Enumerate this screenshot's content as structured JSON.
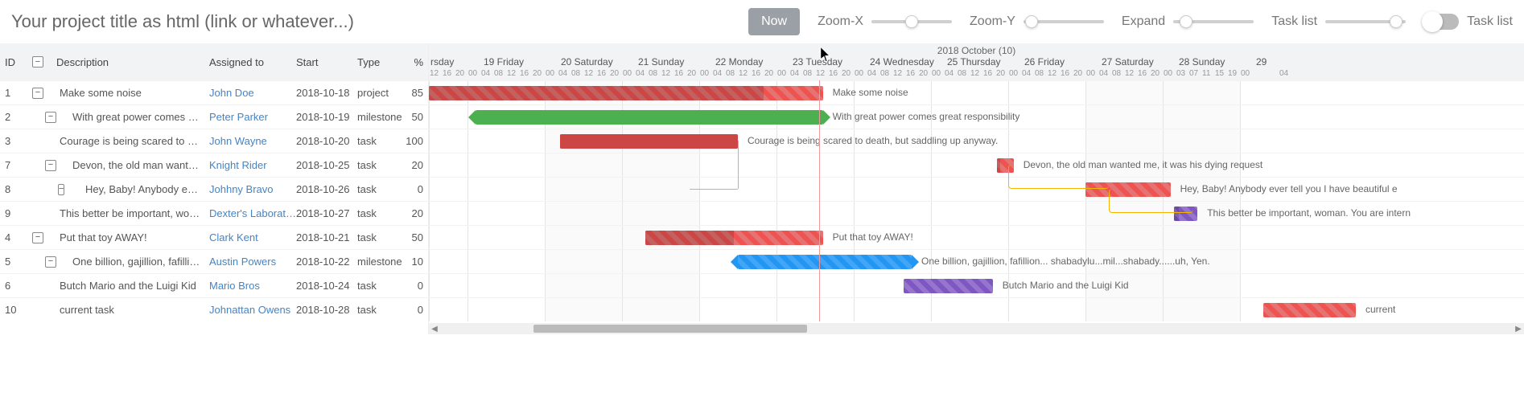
{
  "header": {
    "title": "Your project title as html (link or whatever...)",
    "now_button": "Now",
    "zoom_x": "Zoom-X",
    "zoom_y": "Zoom-Y",
    "expand": "Expand",
    "task_list": "Task list",
    "task_list_switch": "Task list"
  },
  "calendar": {
    "month_label": "2018 October (10)",
    "visible_start_label": "rsday",
    "days": [
      {
        "label": "rsday",
        "dow": 4,
        "weekend": false
      },
      {
        "label": "19 Friday",
        "dow": 5,
        "weekend": false
      },
      {
        "label": "20 Saturday",
        "dow": 6,
        "weekend": true
      },
      {
        "label": "21 Sunday",
        "dow": 0,
        "weekend": true
      },
      {
        "label": "22 Monday",
        "dow": 1,
        "weekend": false
      },
      {
        "label": "23 Tuesday",
        "dow": 2,
        "weekend": false
      },
      {
        "label": "24 Wednesday",
        "dow": 3,
        "weekend": false
      },
      {
        "label": "25 Thursday",
        "dow": 4,
        "weekend": false
      },
      {
        "label": "26 Friday",
        "dow": 5,
        "weekend": false
      },
      {
        "label": "27 Saturday",
        "dow": 6,
        "weekend": true
      },
      {
        "label": "28 Sunday",
        "dow": 0,
        "weekend": true
      },
      {
        "label": "29",
        "dow": 1,
        "weekend": false
      }
    ],
    "hours": [
      "00",
      "04",
      "08",
      "12",
      "16",
      "20"
    ],
    "first_day_hours_visible": [
      "12",
      "16",
      "20"
    ],
    "last_day_hours_visible": [
      "00",
      "04"
    ],
    "sunday28_hours": [
      "00",
      "03",
      "07",
      "11",
      "15",
      "19"
    ],
    "today_line_day_index": 5,
    "today_line_hour_fraction": 0.55
  },
  "columns": {
    "id": "ID",
    "description": "Description",
    "assigned": "Assigned to",
    "start": "Start",
    "type": "Type",
    "pct": "%"
  },
  "rows": [
    {
      "id": "1",
      "exp": true,
      "expLevel": 0,
      "desc": "Make some noise",
      "label": "Make some noise",
      "assigned": "John Doe",
      "start": "2018-10-18",
      "type": "project",
      "pct": "85",
      "color": "red",
      "milestone": false,
      "startDay": 0,
      "startHourFrac": 0,
      "durDays": 5.1
    },
    {
      "id": "2",
      "exp": true,
      "expLevel": 1,
      "desc": "With great power comes great r...",
      "label": "With great power comes great responsibility",
      "assigned": "Peter Parker",
      "start": "2018-10-19",
      "type": "milestone",
      "pct": "50",
      "color": "green",
      "milestone": true,
      "startDay": 0.6,
      "startHourFrac": 0,
      "durDays": 4.5
    },
    {
      "id": "3",
      "exp": false,
      "expLevel": 0,
      "desc": "Courage is being scared to dea...",
      "label": "Courage is being scared to death, but saddling up anyway.",
      "assigned": "John Wayne",
      "start": "2018-10-20",
      "type": "task",
      "pct": "100",
      "color": "red",
      "milestone": false,
      "solid": true,
      "startDay": 1.7,
      "startHourFrac": 0,
      "durDays": 2.3
    },
    {
      "id": "7",
      "exp": true,
      "expLevel": 1,
      "desc": "Devon, the old man wanted me...",
      "label": "Devon, the old man wanted me, it was his dying request",
      "assigned": "Knight Rider",
      "start": "2018-10-25",
      "type": "task",
      "pct": "20",
      "color": "red",
      "milestone": false,
      "startDay": 7.35,
      "startHourFrac": 0,
      "durDays": 0.22
    },
    {
      "id": "8",
      "exp": true,
      "expLevel": 2,
      "desc": "Hey, Baby! Anybody ever tell y...",
      "label": "Hey, Baby! Anybody ever tell you I have beautiful e",
      "assigned": "Johhny Bravo",
      "start": "2018-10-26",
      "type": "task",
      "pct": "0",
      "color": "red",
      "milestone": false,
      "startDay": 8.5,
      "startHourFrac": 0,
      "durDays": 1.1
    },
    {
      "id": "9",
      "exp": false,
      "expLevel": 0,
      "desc": "This better be important, woma...",
      "label": "This better be important, woman. You are intern",
      "assigned": "Dexter's Laboratory",
      "start": "2018-10-27",
      "type": "task",
      "pct": "20",
      "color": "purple",
      "milestone": false,
      "startDay": 9.65,
      "startHourFrac": 0,
      "durDays": 0.3
    },
    {
      "id": "4",
      "exp": true,
      "expLevel": 0,
      "desc": "Put that toy AWAY!",
      "label": "Put that toy AWAY!",
      "assigned": "Clark Kent",
      "start": "2018-10-21",
      "type": "task",
      "pct": "50",
      "color": "red",
      "milestone": false,
      "startDay": 2.8,
      "startHourFrac": 0,
      "durDays": 2.3
    },
    {
      "id": "5",
      "exp": true,
      "expLevel": 1,
      "desc": "One billion, gajillion, fafillion... s...",
      "label": "One billion, gajillion, fafillion... shabadylu...mil...shabady......uh, Yen.",
      "assigned": "Austin Powers",
      "start": "2018-10-22",
      "type": "milestone",
      "pct": "10",
      "color": "blue",
      "milestone": true,
      "startDay": 4.0,
      "startHourFrac": 0,
      "durDays": 2.25
    },
    {
      "id": "6",
      "exp": false,
      "expLevel": 0,
      "desc": "Butch Mario and the Luigi Kid",
      "label": "Butch Mario and the Luigi Kid",
      "assigned": "Mario Bros",
      "start": "2018-10-24",
      "type": "task",
      "pct": "0",
      "color": "purple",
      "milestone": false,
      "startDay": 6.15,
      "startHourFrac": 0,
      "durDays": 1.15
    },
    {
      "id": "10",
      "exp": false,
      "expLevel": 0,
      "desc": "current task",
      "label": "current",
      "assigned": "Johnattan Owens",
      "start": "2018-10-28",
      "type": "task",
      "pct": "0",
      "color": "red",
      "milestone": false,
      "startDay": 10.8,
      "startHourFrac": 0,
      "durDays": 1.2
    }
  ],
  "colors": {
    "red": "#ef5350",
    "green": "#4caf50",
    "blue": "#2196f3",
    "purple": "#7e57c2",
    "link_blue": "#4285c8"
  }
}
